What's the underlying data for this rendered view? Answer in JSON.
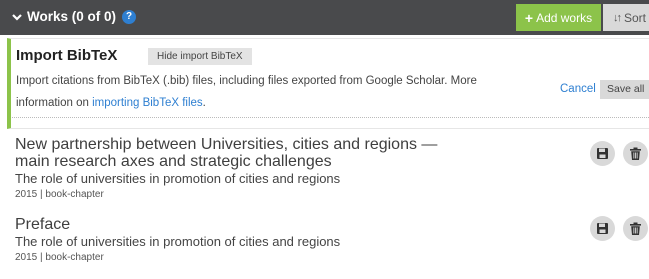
{
  "header": {
    "title": "Works (0 of 0)",
    "help": "?",
    "add_label": "Add works",
    "sort_label": "Sort"
  },
  "import_panel": {
    "title": "Import BibTeX",
    "hide_label": "Hide import BibTeX",
    "description_prefix": "Import citations from BibTeX (.bib) files, including files exported from Google Scholar. More information on ",
    "description_link": "importing BibTeX files",
    "description_suffix": ".",
    "cancel_label": "Cancel",
    "save_all_label": "Save all"
  },
  "works": [
    {
      "title": "New partnership between Universities, cities and regions — main research axes and strategic challenges",
      "journal": "The role of universities in promotion of cities and regions",
      "meta": "2015 | book-chapter"
    },
    {
      "title": "Preface",
      "journal": "The role of universities in promotion of cities and regions",
      "meta": "2015 | book-chapter"
    }
  ],
  "colors": {
    "header_bg": "#494a4c",
    "accent_green": "#8cc34a",
    "link_blue": "#2e7fd1",
    "button_gray": "#d9d9d9"
  },
  "icons": [
    "chevron-down-icon",
    "help-icon",
    "plus-icon",
    "sort-icon",
    "save-icon",
    "trash-icon"
  ]
}
